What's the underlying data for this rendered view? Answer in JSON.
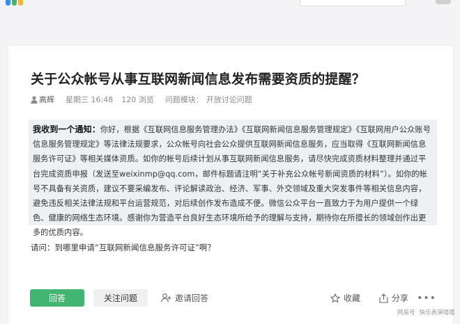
{
  "question": {
    "title": "关于公众帐号从事互联网新闻信息发布需要资质的提醒？",
    "author": "高辉",
    "time": "星期三 16:48",
    "views": "120 浏览",
    "module_label": "问题模块：",
    "module_name": "开放讨论问题",
    "quote_lead": "我收到一个通知：",
    "quote_body": "你好，根据《互联网信息服务管理办法》《互联网新闻信息服务管理规定》《互联网用户公众账号信息服务管理规定》等法律法规要求，公众帐号向社会公众提供互联网新闻信息服务，应当取得《互联网新闻信息服务许可证》等相关媒体资质。如你的帐号后续计划从事互联网新闻信息服务，请尽快完成资质材料整理并通过平台完成资质申报（发送至weixinmp@qq.com，邮件标题请注明“关于补充公众帐号新闻资质的材料”）。如你的帐号不具备有关资质，建议不要采编发布、评论解读政治、经济、军事、外交领域及重大突发事件等相关信息内容，避免违反相关法律法规和平台运营规范，对后续创作发布造成不便。微信公众平台一直致力于为用户提供一个绿色、健康的网络生态环境。感谢你为营造平台良好生态环境所给予的理解与支持，期待你在所擅长的领域创作出更多的优质内容。",
    "ask": "请问：到哪里申请“互联网新闻信息服务许可证”啊？"
  },
  "actions": {
    "answer": "回答",
    "follow": "关注问题",
    "invite": "邀请回答",
    "favorite": "收藏",
    "share": "分享",
    "more": "•••"
  },
  "watermark": {
    "left": "网易号",
    "right": "快乐表演嘻嘻"
  },
  "colors": {
    "accent_green": "#43b572",
    "quote_bg": "#eef0f4"
  }
}
